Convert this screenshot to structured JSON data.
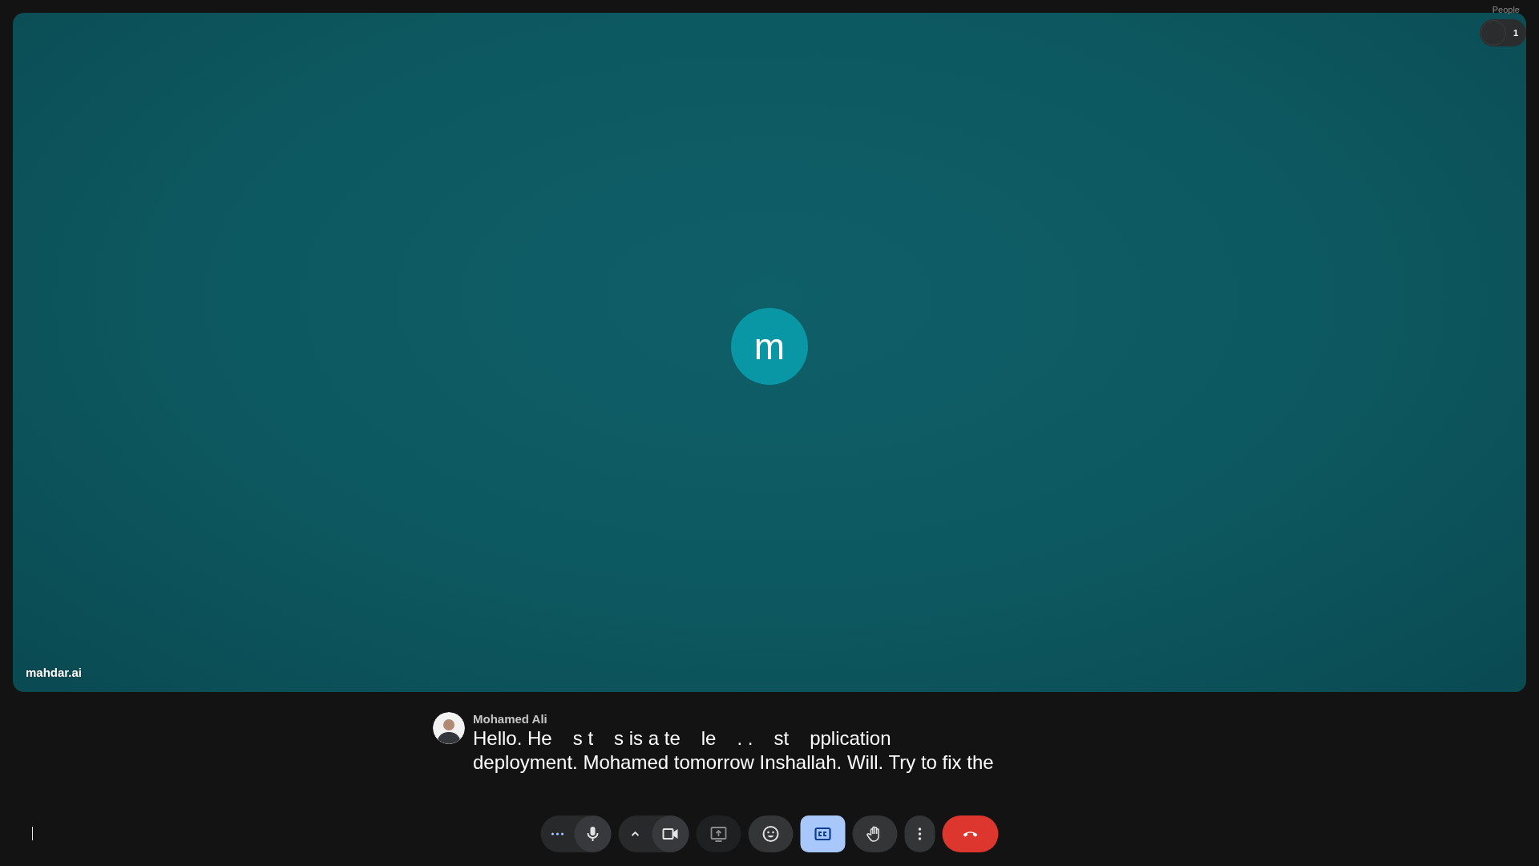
{
  "tile": {
    "avatar_letter": "m",
    "name": "mahdar.ai"
  },
  "people": {
    "label": "People",
    "count": "1"
  },
  "caption": {
    "speaker": "Mohamed Ali",
    "line_1_fragments": [
      "Hello. He",
      "s t",
      "s is a te",
      "le",
      ". .",
      "st",
      "pplication"
    ],
    "line_2": "deployment. Mohamed tomorrow Inshallah. Will. Try to fix the"
  },
  "toolbar": [
    {
      "kind": "more",
      "on": false
    },
    {
      "kind": "mic",
      "on": false
    },
    {
      "kind": "caret",
      "on": false
    },
    {
      "kind": "camera",
      "on": false
    },
    {
      "kind": "present",
      "on": false
    },
    {
      "kind": "emoji",
      "on": false
    },
    {
      "kind": "captions",
      "on": true
    },
    {
      "kind": "hand",
      "on": false
    },
    {
      "kind": "more_vert",
      "on": false
    },
    {
      "kind": "end_call",
      "on": false
    }
  ]
}
